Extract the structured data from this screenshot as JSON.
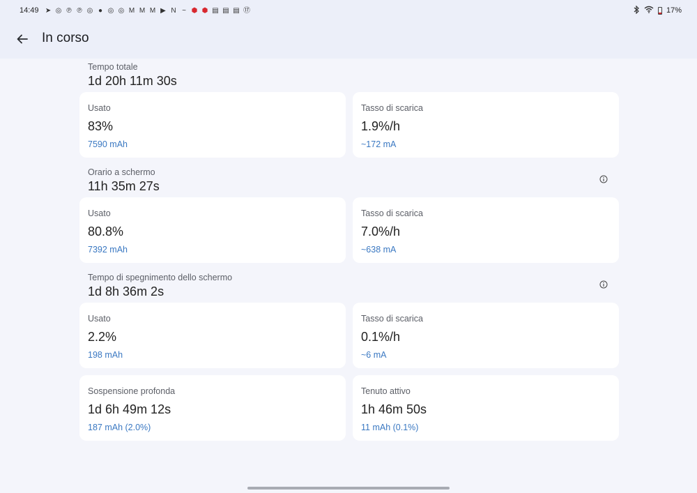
{
  "status_bar": {
    "time": "14:49",
    "notification_icons": [
      {
        "icon": "telegram-icon",
        "glyph": "➤"
      },
      {
        "icon": "instagram-icon",
        "glyph": "◎"
      },
      {
        "icon": "pinterest-icon",
        "glyph": "℗"
      },
      {
        "icon": "pinterest-icon",
        "glyph": "℗"
      },
      {
        "icon": "instagram-icon",
        "glyph": "◎"
      },
      {
        "icon": "reddit-icon",
        "glyph": "●"
      },
      {
        "icon": "instagram-icon",
        "glyph": "◎"
      },
      {
        "icon": "instagram-icon",
        "glyph": "◎"
      },
      {
        "icon": "gmail-icon",
        "glyph": "M"
      },
      {
        "icon": "gmail-icon",
        "glyph": "M"
      },
      {
        "icon": "gmail-icon",
        "glyph": "M"
      },
      {
        "icon": "youtube-icon",
        "glyph": "▶"
      },
      {
        "icon": "netflix-icon",
        "glyph": "N"
      },
      {
        "icon": "amazon-icon",
        "glyph": "~"
      },
      {
        "icon": "app-red-icon",
        "glyph": "⬢"
      },
      {
        "icon": "app-red-icon",
        "glyph": "⬢"
      },
      {
        "icon": "news-icon",
        "glyph": "▤"
      },
      {
        "icon": "news-icon",
        "glyph": "▤"
      },
      {
        "icon": "news-icon",
        "glyph": "▤"
      },
      {
        "icon": "calendar-17-icon",
        "glyph": "⑰"
      }
    ],
    "battery_percent": "17%"
  },
  "app_bar": {
    "title": "In corso"
  },
  "sections": {
    "total": {
      "label": "Tempo totale",
      "value": "1d 20h 11m 30s",
      "used": {
        "label": "Usato",
        "value": "83%",
        "sub": "7590 mAh"
      },
      "rate": {
        "label": "Tasso di scarica",
        "value": "1.9%/h",
        "sub": "~172 mA"
      }
    },
    "screen_on": {
      "label": "Orario a schermo",
      "value": "11h 35m 27s",
      "used": {
        "label": "Usato",
        "value": "80.8%",
        "sub": "7392 mAh"
      },
      "rate": {
        "label": "Tasso di scarica",
        "value": "7.0%/h",
        "sub": "~638 mA"
      }
    },
    "screen_off": {
      "label": "Tempo di spegnimento dello schermo",
      "value": "1d 8h 36m 2s",
      "used": {
        "label": "Usato",
        "value": "2.2%",
        "sub": "198 mAh"
      },
      "rate": {
        "label": "Tasso di scarica",
        "value": "0.1%/h",
        "sub": "~6 mA"
      }
    },
    "sleep": {
      "deep": {
        "label": "Sospensione profonda",
        "value": "1d 6h 49m 12s",
        "sub": "187 mAh (2.0%)"
      },
      "awake": {
        "label": "Tenuto attivo",
        "value": "1h 46m 50s",
        "sub": "11 mAh (0.1%)"
      }
    }
  },
  "colors": {
    "accent": "#3a78c2",
    "background": "#f4f5fb",
    "bar": "#eceff9",
    "card": "#ffffff"
  }
}
